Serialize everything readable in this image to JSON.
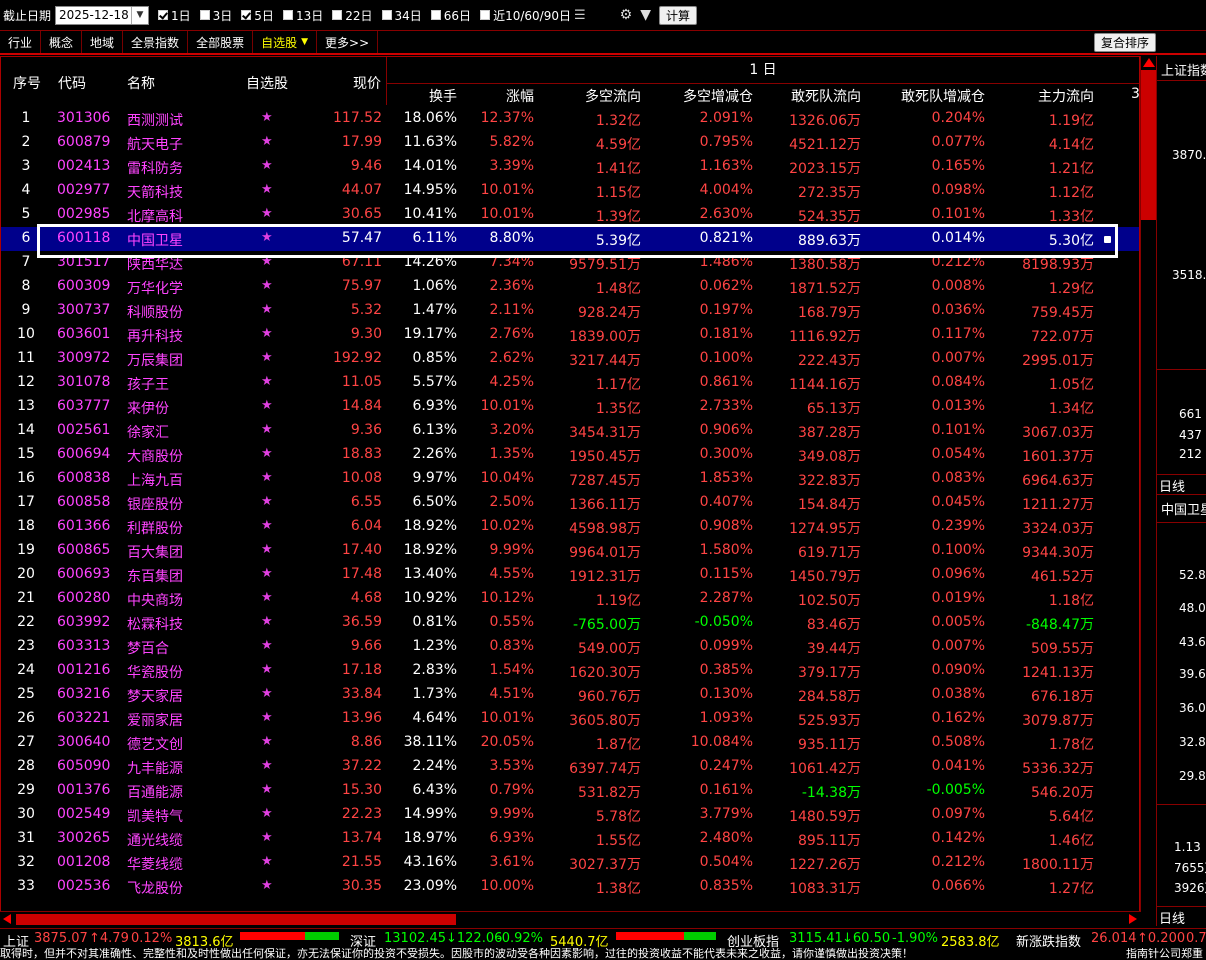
{
  "toolbar": {
    "date_label": "截止日期",
    "date_value": "2025-12-18",
    "periods": [
      {
        "label": "1日",
        "checked": true
      },
      {
        "label": "3日",
        "checked": false
      },
      {
        "label": "5日",
        "checked": true
      },
      {
        "label": "13日",
        "checked": false
      },
      {
        "label": "22日",
        "checked": false
      },
      {
        "label": "34日",
        "checked": false
      },
      {
        "label": "66日",
        "checked": false
      },
      {
        "label": "近10/60/90日",
        "checked": false
      }
    ],
    "calc_label": "计算"
  },
  "tabs": [
    {
      "label": "行业",
      "active": false
    },
    {
      "label": "概念",
      "active": false
    },
    {
      "label": "地域",
      "active": false
    },
    {
      "label": "全景指数",
      "active": false
    },
    {
      "label": "全部股票",
      "active": false
    },
    {
      "label": "自选股",
      "active": true,
      "dropdown": true
    },
    {
      "label": "更多>>",
      "active": false
    }
  ],
  "sort_button": "复合排序",
  "table": {
    "group_header": "1 日",
    "left_headers": {
      "idx": "序号",
      "code": "代码",
      "name": "名称",
      "fav": "自选股",
      "price": "现价"
    },
    "right_headers": [
      "换手",
      "涨幅",
      "多空流向",
      "多空增减仓",
      "敢死队流向",
      "敢死队增减仓",
      "主力流向"
    ],
    "selected_index": 5,
    "rows": [
      [
        "1",
        "301306",
        "西测测试",
        "117.52",
        "18.06%",
        "12.37%",
        "1.32亿",
        "2.091%",
        "1326.06万",
        "0.204%",
        "1.19亿"
      ],
      [
        "2",
        "600879",
        "航天电子",
        "17.99",
        "11.63%",
        "5.82%",
        "4.59亿",
        "0.795%",
        "4521.12万",
        "0.077%",
        "4.14亿"
      ],
      [
        "3",
        "002413",
        "雷科防务",
        "9.46",
        "14.01%",
        "3.39%",
        "1.41亿",
        "1.163%",
        "2023.15万",
        "0.165%",
        "1.21亿"
      ],
      [
        "4",
        "002977",
        "天箭科技",
        "44.07",
        "14.95%",
        "10.01%",
        "1.15亿",
        "4.004%",
        "272.35万",
        "0.098%",
        "1.12亿"
      ],
      [
        "5",
        "002985",
        "北摩高科",
        "30.65",
        "10.41%",
        "10.01%",
        "1.39亿",
        "2.630%",
        "524.35万",
        "0.101%",
        "1.33亿"
      ],
      [
        "6",
        "600118",
        "中国卫星",
        "57.47",
        "6.11%",
        "8.80%",
        "5.39亿",
        "0.821%",
        "889.63万",
        "0.014%",
        "5.30亿"
      ],
      [
        "7",
        "301517",
        "陕西华达",
        "67.11",
        "14.26%",
        "7.34%",
        "9579.51万",
        "1.486%",
        "1380.58万",
        "0.212%",
        "8198.93万"
      ],
      [
        "8",
        "600309",
        "万华化学",
        "75.97",
        "1.06%",
        "2.36%",
        "1.48亿",
        "0.062%",
        "1871.52万",
        "0.008%",
        "1.29亿"
      ],
      [
        "9",
        "300737",
        "科顺股份",
        "5.32",
        "1.47%",
        "2.11%",
        "928.24万",
        "0.197%",
        "168.79万",
        "0.036%",
        "759.45万"
      ],
      [
        "10",
        "603601",
        "再升科技",
        "9.30",
        "19.17%",
        "2.76%",
        "1839.00万",
        "0.181%",
        "1116.92万",
        "0.117%",
        "722.07万"
      ],
      [
        "11",
        "300972",
        "万辰集团",
        "192.92",
        "0.85%",
        "2.62%",
        "3217.44万",
        "0.100%",
        "222.43万",
        "0.007%",
        "2995.01万"
      ],
      [
        "12",
        "301078",
        "孩子王",
        "11.05",
        "5.57%",
        "4.25%",
        "1.17亿",
        "0.861%",
        "1144.16万",
        "0.084%",
        "1.05亿"
      ],
      [
        "13",
        "603777",
        "来伊份",
        "14.84",
        "6.93%",
        "10.01%",
        "1.35亿",
        "2.733%",
        "65.13万",
        "0.013%",
        "1.34亿"
      ],
      [
        "14",
        "002561",
        "徐家汇",
        "9.36",
        "6.13%",
        "3.20%",
        "3454.31万",
        "0.906%",
        "387.28万",
        "0.101%",
        "3067.03万"
      ],
      [
        "15",
        "600694",
        "大商股份",
        "18.83",
        "2.26%",
        "1.35%",
        "1950.45万",
        "0.300%",
        "349.08万",
        "0.054%",
        "1601.37万"
      ],
      [
        "16",
        "600838",
        "上海九百",
        "10.08",
        "9.97%",
        "10.04%",
        "7287.45万",
        "1.853%",
        "322.83万",
        "0.083%",
        "6964.63万"
      ],
      [
        "17",
        "600858",
        "银座股份",
        "6.55",
        "6.50%",
        "2.50%",
        "1366.11万",
        "0.407%",
        "154.84万",
        "0.045%",
        "1211.27万"
      ],
      [
        "18",
        "601366",
        "利群股份",
        "6.04",
        "18.92%",
        "10.02%",
        "4598.98万",
        "0.908%",
        "1274.95万",
        "0.239%",
        "3324.03万"
      ],
      [
        "19",
        "600865",
        "百大集团",
        "17.40",
        "18.92%",
        "9.99%",
        "9964.01万",
        "1.580%",
        "619.71万",
        "0.100%",
        "9344.30万"
      ],
      [
        "20",
        "600693",
        "东百集团",
        "17.48",
        "13.40%",
        "4.55%",
        "1912.31万",
        "0.115%",
        "1450.79万",
        "0.096%",
        "461.52万"
      ],
      [
        "21",
        "600280",
        "中央商场",
        "4.68",
        "10.92%",
        "10.12%",
        "1.19亿",
        "2.287%",
        "102.50万",
        "0.019%",
        "1.18亿"
      ],
      [
        "22",
        "603992",
        "松霖科技",
        "36.59",
        "0.81%",
        "0.55%",
        "-765.00万",
        "-0.050%",
        "83.46万",
        "0.005%",
        "-848.47万"
      ],
      [
        "23",
        "603313",
        "梦百合",
        "9.66",
        "1.23%",
        "0.83%",
        "549.00万",
        "0.099%",
        "39.44万",
        "0.007%",
        "509.55万"
      ],
      [
        "24",
        "001216",
        "华瓷股份",
        "17.18",
        "2.83%",
        "1.54%",
        "1620.30万",
        "0.385%",
        "379.17万",
        "0.090%",
        "1241.13万"
      ],
      [
        "25",
        "603216",
        "梦天家居",
        "33.84",
        "1.73%",
        "4.51%",
        "960.76万",
        "0.130%",
        "284.58万",
        "0.038%",
        "676.18万"
      ],
      [
        "26",
        "603221",
        "爱丽家居",
        "13.96",
        "4.64%",
        "10.01%",
        "3605.80万",
        "1.093%",
        "525.93万",
        "0.162%",
        "3079.87万"
      ],
      [
        "27",
        "300640",
        "德艺文创",
        "8.86",
        "38.11%",
        "20.05%",
        "1.87亿",
        "10.084%",
        "935.11万",
        "0.508%",
        "1.78亿"
      ],
      [
        "28",
        "605090",
        "九丰能源",
        "37.22",
        "2.24%",
        "3.53%",
        "6397.74万",
        "0.247%",
        "1061.42万",
        "0.041%",
        "5336.32万"
      ],
      [
        "29",
        "001376",
        "百通能源",
        "15.30",
        "6.43%",
        "0.79%",
        "531.82万",
        "0.161%",
        "-14.38万",
        "-0.005%",
        "546.20万"
      ],
      [
        "30",
        "002549",
        "凯美特气",
        "22.23",
        "14.99%",
        "9.99%",
        "5.78亿",
        "3.779%",
        "1480.59万",
        "0.097%",
        "5.64亿"
      ],
      [
        "31",
        "300265",
        "通光线缆",
        "13.74",
        "18.97%",
        "6.93%",
        "1.55亿",
        "2.480%",
        "895.11万",
        "0.142%",
        "1.46亿"
      ],
      [
        "32",
        "001208",
        "华菱线缆",
        "21.55",
        "43.16%",
        "3.61%",
        "3027.37万",
        "0.504%",
        "1227.26万",
        "0.212%",
        "1800.11万"
      ],
      [
        "33",
        "002536",
        "飞龙股份",
        "30.35",
        "23.09%",
        "10.00%",
        "1.38亿",
        "0.835%",
        "1083.31万",
        "0.066%",
        "1.27亿"
      ]
    ]
  },
  "side_panel": {
    "top_label": "上证指数",
    "values_top": [
      "3870.",
      "3518."
    ],
    "values_mid": [
      "661",
      "437",
      "212"
    ],
    "day_label": "日线",
    "stock_label": "中国卫星",
    "price_ticks": [
      "52.8",
      "48.0",
      "43.6",
      "39.6",
      "36.0",
      "32.8",
      "29.8"
    ],
    "vol_ticks": [
      "1.13",
      "7655万",
      "3926万"
    ],
    "bottom_label": "日线"
  },
  "status_bar": {
    "sh_label": "上证",
    "sh_value": "3875.07",
    "sh_change": "↑4.79",
    "sh_pct": "0.12%",
    "sh_amount": "3813.6亿",
    "sz_label": "深证",
    "sz_value": "13102.45",
    "sz_change": "↓122.06",
    "sz_pct": "-0.92%",
    "sz_amount": "5440.7亿",
    "cy_label": "创业板指",
    "cy_value": "3115.41",
    "cy_change": "↓60.50",
    "cy_pct": "-1.90%",
    "cy_amount": "2583.8亿",
    "xz_label": "新涨跌指数",
    "xz_value": "26.014",
    "xz_change": "↑0.200",
    "xz_pct": "0.7"
  },
  "ticker_text": "取得时，但并不对其准确性、完整性和及时性做出任何保证，亦无法保证你的投资不受损失。因股市的波动受各种因素影响，过往的投资收益不能代表未来之收益，请你谨慎做出投资决策！",
  "ticker_right": "指南针公司郑重",
  "colors": {
    "up": "#ff4444",
    "down": "#00ff00",
    "code": "#ff44ff",
    "selected_row": "#00008b",
    "accent_tab": "#ffff00"
  }
}
